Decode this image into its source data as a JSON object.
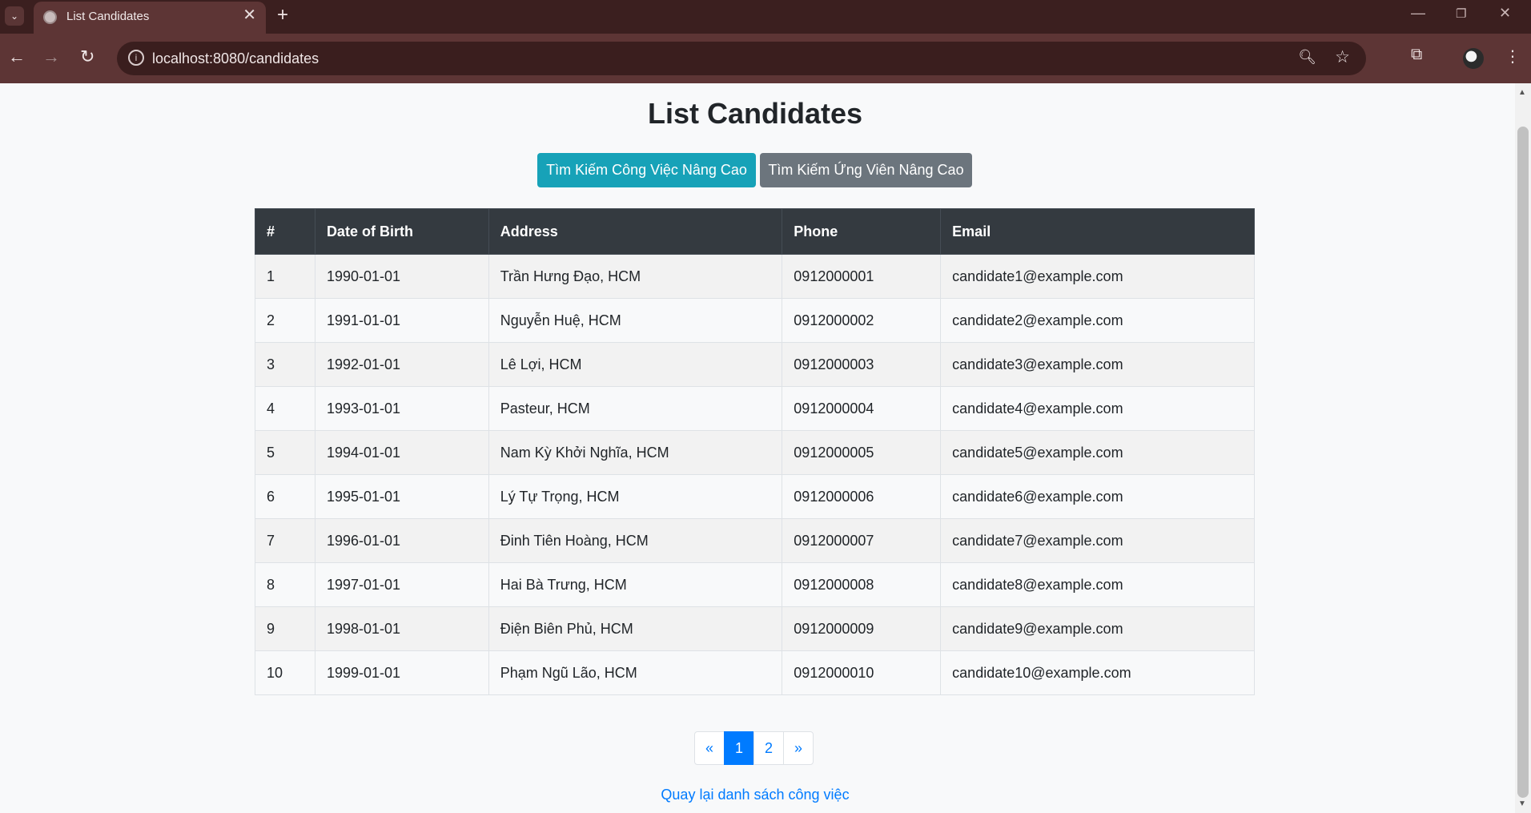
{
  "browser": {
    "tab_title": "List Candidates",
    "url": "localhost:8080/candidates",
    "tab_close": "✕",
    "new_tab": "+"
  },
  "page": {
    "title": "List Candidates",
    "buttons": {
      "search_jobs": "Tìm Kiếm Công Việc Nâng Cao",
      "search_candidates": "Tìm Kiếm Ứng Viên Nâng Cao"
    },
    "table": {
      "headers": [
        "#",
        "Date of Birth",
        "Address",
        "Phone",
        "Email"
      ],
      "rows": [
        [
          "1",
          "1990-01-01",
          "Trần Hưng Đạo, HCM",
          "0912000001",
          "candidate1@example.com"
        ],
        [
          "2",
          "1991-01-01",
          "Nguyễn Huệ, HCM",
          "0912000002",
          "candidate2@example.com"
        ],
        [
          "3",
          "1992-01-01",
          "Lê Lợi, HCM",
          "0912000003",
          "candidate3@example.com"
        ],
        [
          "4",
          "1993-01-01",
          "Pasteur, HCM",
          "0912000004",
          "candidate4@example.com"
        ],
        [
          "5",
          "1994-01-01",
          "Nam Kỳ Khởi Nghĩa, HCM",
          "0912000005",
          "candidate5@example.com"
        ],
        [
          "6",
          "1995-01-01",
          "Lý Tự Trọng, HCM",
          "0912000006",
          "candidate6@example.com"
        ],
        [
          "7",
          "1996-01-01",
          "Đinh Tiên Hoàng, HCM",
          "0912000007",
          "candidate7@example.com"
        ],
        [
          "8",
          "1997-01-01",
          "Hai Bà Trưng, HCM",
          "0912000008",
          "candidate8@example.com"
        ],
        [
          "9",
          "1998-01-01",
          "Điện Biên Phủ, HCM",
          "0912000009",
          "candidate9@example.com"
        ],
        [
          "10",
          "1999-01-01",
          "Phạm Ngũ Lão, HCM",
          "0912000010",
          "candidate10@example.com"
        ]
      ]
    },
    "pagination": {
      "prev": "«",
      "pages": [
        "1",
        "2"
      ],
      "active": "1",
      "next": "»"
    },
    "back_link": "Quay lại danh sách công việc"
  },
  "colors": {
    "primary": "#007bff",
    "info": "#17a2b8",
    "secondary": "#6c757d",
    "table_header": "#343a40",
    "browser_frame": "#5d3535"
  }
}
